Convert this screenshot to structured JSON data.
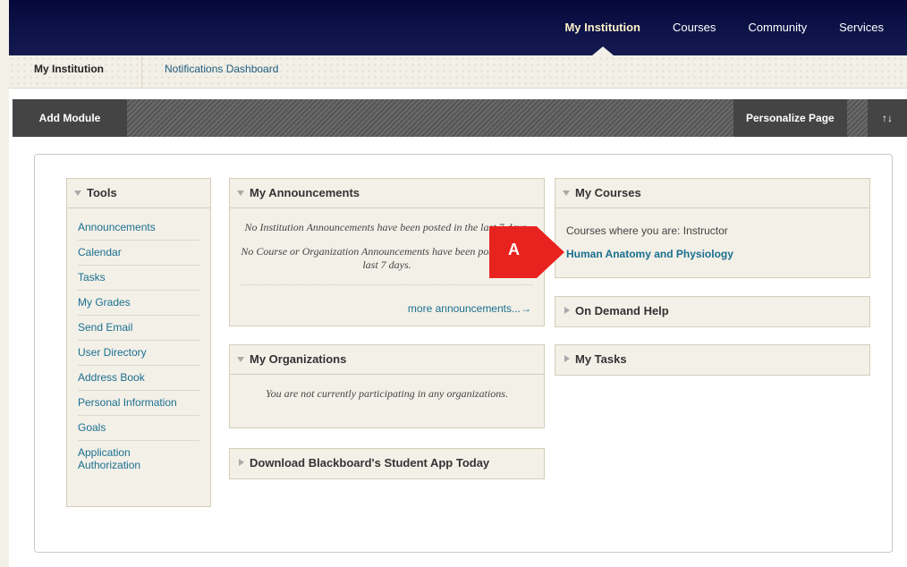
{
  "topnav": {
    "items": [
      {
        "label": "My Institution",
        "active": true
      },
      {
        "label": "Courses",
        "active": false
      },
      {
        "label": "Community",
        "active": false
      },
      {
        "label": "Services",
        "active": false
      }
    ]
  },
  "subtabs": {
    "active": "My Institution",
    "link": "Notifications Dashboard"
  },
  "toolbar": {
    "add_module": "Add Module",
    "personalize": "Personalize Page",
    "sort_icon": "↑↓"
  },
  "tools": {
    "title": "Tools",
    "items": [
      "Announcements",
      "Calendar",
      "Tasks",
      "My Grades",
      "Send Email",
      "User Directory",
      "Address Book",
      "Personal Information",
      "Goals",
      "Application Authorization"
    ]
  },
  "announcements": {
    "title": "My Announcements",
    "institution_msg": "No Institution Announcements have been posted in the last 7 days.",
    "course_msg": "No Course or Organization Announcements have been posted in the last 7 days.",
    "more_link": "more announcements...→"
  },
  "organizations": {
    "title": "My Organizations",
    "message": "You are not currently participating in any organizations."
  },
  "download": {
    "title": "Download Blackboard's Student App Today"
  },
  "courses": {
    "title": "My Courses",
    "subtitle": "Courses where you are: Instructor",
    "items": [
      "Human Anatomy and Physiology"
    ]
  },
  "ondemand": {
    "title": "On Demand Help"
  },
  "tasks": {
    "title": "My Tasks"
  },
  "marker": {
    "label": "A",
    "color": "#e8231f"
  },
  "colors": {
    "topbar": "#0e1449",
    "link": "#1a6f8f",
    "module_bg": "#f3f0e8"
  }
}
